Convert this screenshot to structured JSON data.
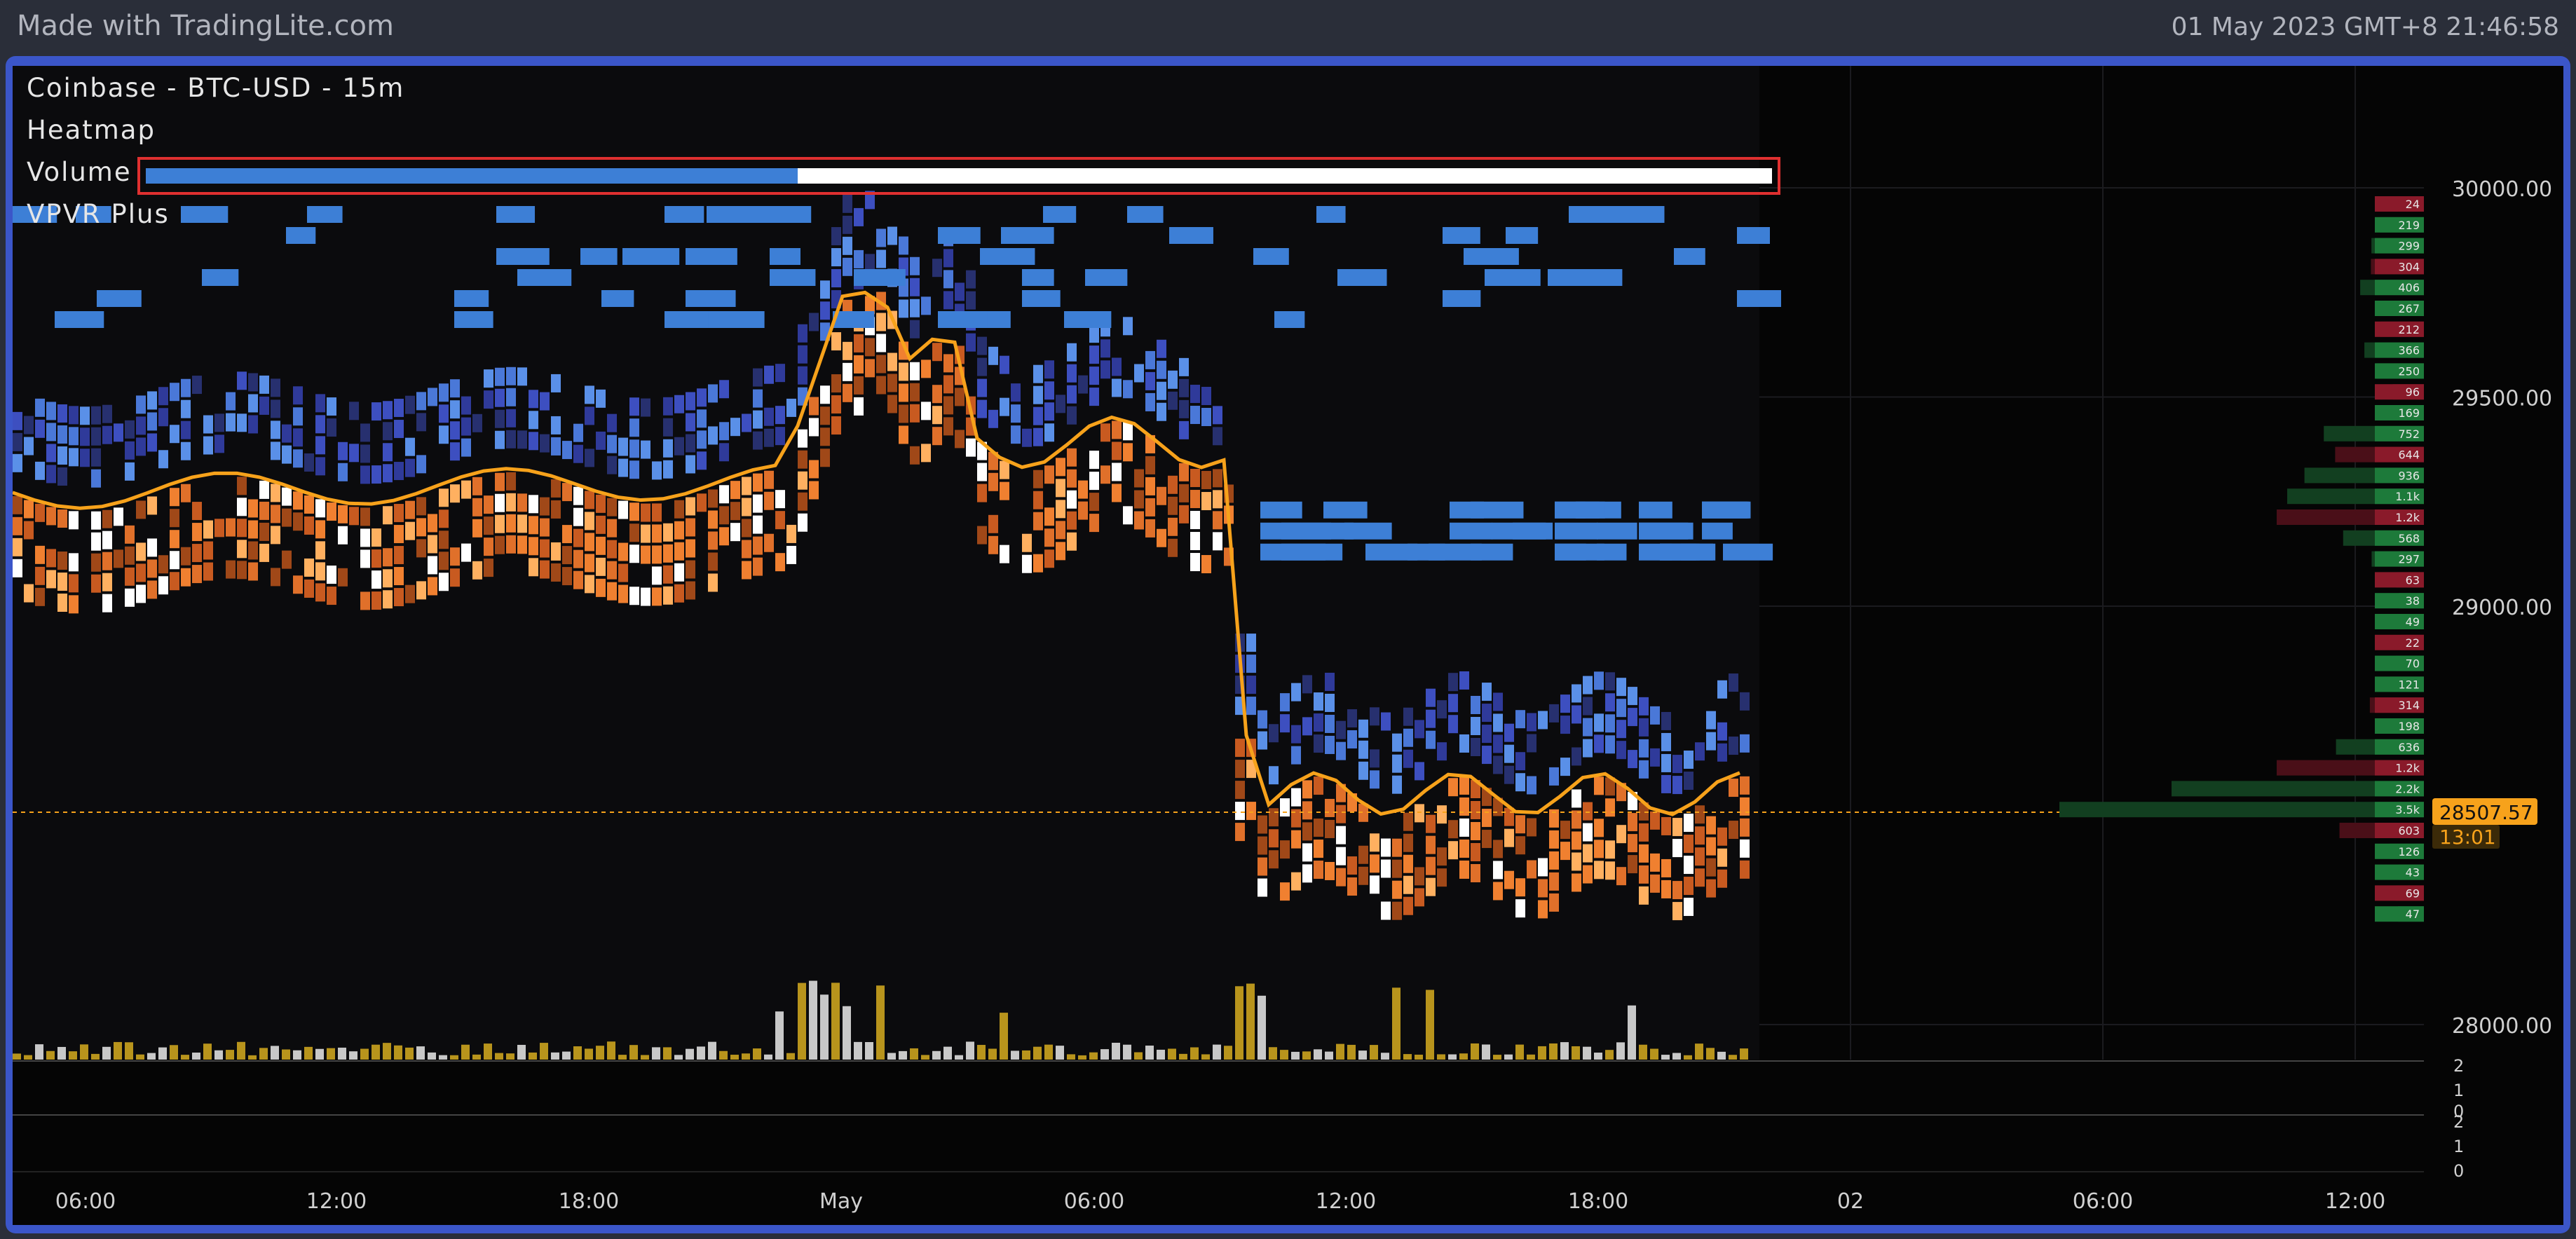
{
  "header": {
    "watermark": "Made with TradingLite.com",
    "datetime": "01 May 2023 GMT+8 21:46:58"
  },
  "legend": {
    "instrument": "Coinbase - BTC-USD - 15m",
    "heatmap": "Heatmap",
    "volume": "Volume",
    "vpvr": "VPVR Plus"
  },
  "price_axis": {
    "ticks": [
      "30000.00",
      "29500.00",
      "29000.00",
      "28000.00"
    ],
    "current_price": "28507.57",
    "countdown": "13:01"
  },
  "volume_pane_axis": {
    "ticks": [
      "2",
      "1",
      "0",
      "2",
      "1",
      "0"
    ]
  },
  "time_axis": {
    "ticks": [
      "06:00",
      "12:00",
      "18:00",
      "May",
      "06:00",
      "12:00",
      "18:00",
      "02",
      "06:00",
      "12:00"
    ]
  },
  "vpvr_labels": [
    "24",
    "219",
    "299",
    "304",
    "406",
    "267",
    "212",
    "366",
    "250",
    "96",
    "169",
    "752",
    "644",
    "936",
    "1.1k",
    "1.2k",
    "568",
    "297",
    "63",
    "38",
    "49",
    "22",
    "70",
    "121",
    "314",
    "198",
    "636",
    "1.2k",
    "2.2k",
    "3.5k",
    "603",
    "126",
    "43",
    "69",
    "47"
  ],
  "colors": {
    "background": "#050505",
    "frame": "#3b56c9",
    "orderbook_blue": "#3d6fd6",
    "heat_orange": "#f08030",
    "volume_gold": "#b8941c",
    "price_line": "#f7a21b",
    "buy_green": "#1d7a3a",
    "sell_red": "#8a1a2a"
  }
}
